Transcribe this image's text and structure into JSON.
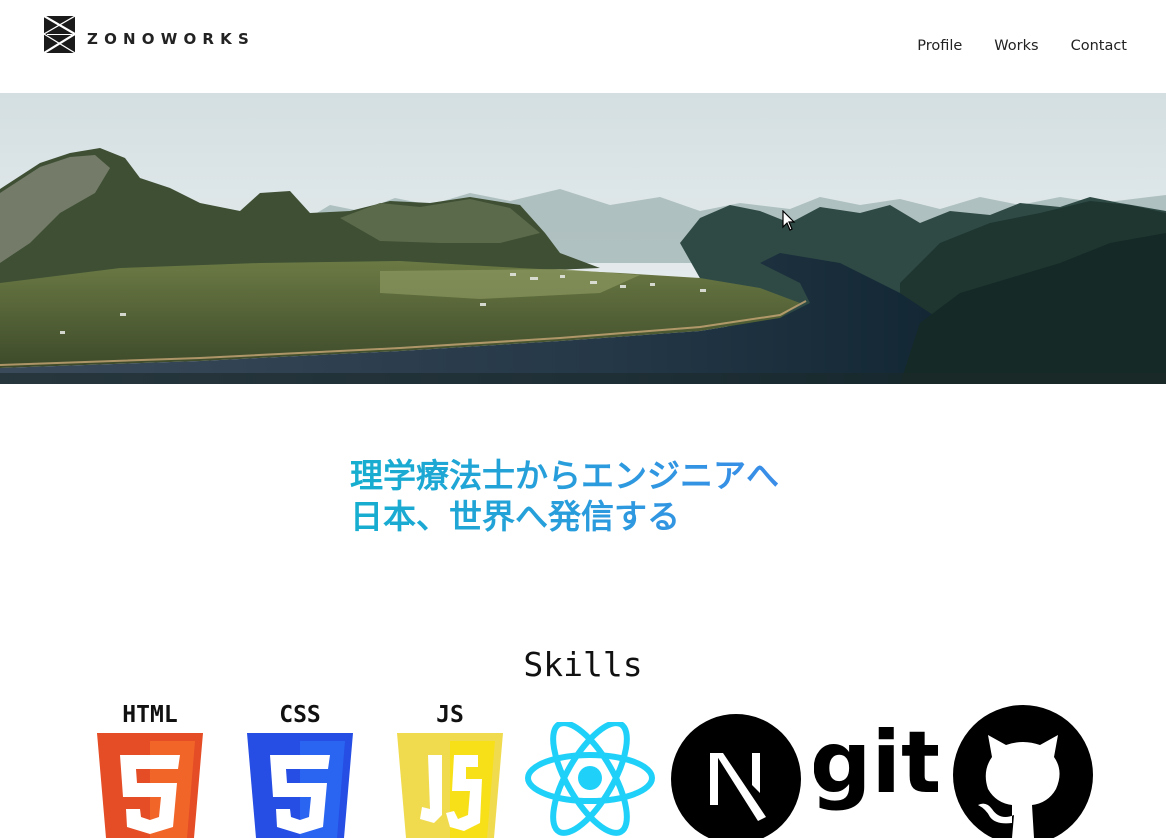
{
  "header": {
    "brand": "ZONOWORKS",
    "nav": [
      "Profile",
      "Works",
      "Contact"
    ]
  },
  "hero": {
    "description_icon": "landscape-image"
  },
  "tagline": {
    "line1": "理学療法士からエンジニアへ",
    "line2": "日本、世界へ発信する"
  },
  "skills": {
    "title": "Skills",
    "items": [
      {
        "label": "HTML",
        "icon": "html5-icon",
        "color": "#e44d26"
      },
      {
        "label": "CSS",
        "icon": "css3-icon",
        "color": "#264de4"
      },
      {
        "label": "JS",
        "icon": "javascript-icon",
        "color": "#f0db4f"
      },
      {
        "label": "",
        "icon": "react-icon",
        "color": "#1fd1f9"
      },
      {
        "label": "N",
        "icon": "nextjs-icon",
        "color": "#000000"
      },
      {
        "label": "git",
        "icon": "git-icon",
        "color": "#000000"
      },
      {
        "label": "",
        "icon": "github-icon",
        "color": "#000000"
      }
    ]
  },
  "colors": {
    "accent_start": "#16aecf",
    "accent_end": "#3a8de8"
  }
}
